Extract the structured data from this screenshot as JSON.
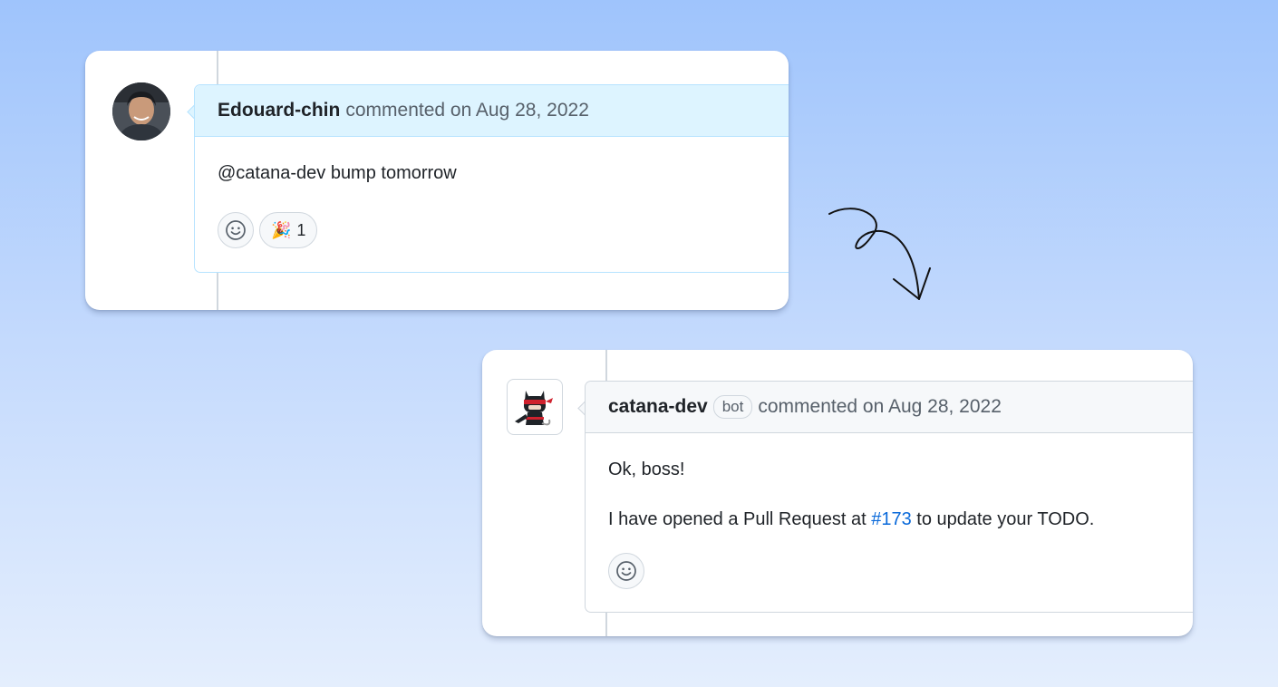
{
  "comments": [
    {
      "author": "Edouard-chin",
      "meta": "commented on Aug 28, 2022",
      "body": [
        "@catana-dev bump tomorrow"
      ],
      "reactions": [
        {
          "emoji": "🎉",
          "count": "1"
        }
      ]
    },
    {
      "author": "catana-dev",
      "badge": "bot",
      "meta": "commented on Aug 28, 2022",
      "body_line1": "Ok, boss!",
      "body_line2": {
        "before": "I have opened a Pull Request at ",
        "link": "#173",
        "after": " to update your TODO."
      }
    }
  ],
  "icons": {
    "add_reaction": "smiley-icon",
    "arrow": "curly-arrow-icon"
  },
  "colors": {
    "link": "#0969da",
    "highlight_header": "#ddf4ff",
    "highlight_border": "#b6e3ff"
  }
}
